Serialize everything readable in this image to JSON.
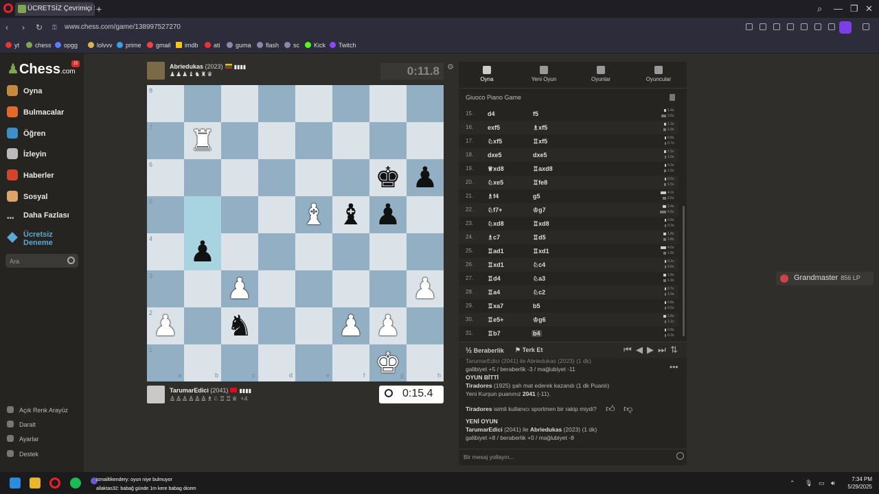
{
  "browser": {
    "tab_title": "ÜCRETSİZ Çevrimiçi S...",
    "url": "www.chess.com/game/138997527270",
    "bookmarks": [
      "yt",
      "chess",
      "opgg",
      "lolvvv",
      "prime",
      "gmail",
      "imdb",
      "ati",
      "guma",
      "flash",
      "sc",
      "Kick",
      "Twitch"
    ]
  },
  "sidebar": {
    "logo": "Chess",
    "logo_suffix": ".com",
    "badge": "15",
    "nav": [
      "Oyna",
      "Bulmacalar",
      "Öğren",
      "İzleyin",
      "Haberler",
      "Sosyal",
      "Daha Fazlası"
    ],
    "premium_line1": "Ücretsiz",
    "premium_line2": "Deneme",
    "search_placeholder": "Ara",
    "bottom": [
      "Açık Renk Arayüz",
      "Daralt",
      "Ayarlar",
      "Destek"
    ]
  },
  "top_player": {
    "name": "Abriedukas",
    "rating": "(2023)",
    "time": "0:11.8",
    "captured": "♟♟♟♝♞♜♛"
  },
  "bottom_player": {
    "name": "TarumarEdici",
    "rating": "(2041)",
    "time": "0:15.4",
    "captured": "♙♙♙♙♙♙♗♘♖♖♕",
    "advantage": "+4"
  },
  "board": {
    "files": [
      "a",
      "b",
      "c",
      "d",
      "e",
      "f",
      "g",
      "h"
    ],
    "ranks": [
      "8",
      "7",
      "6",
      "5",
      "4",
      "3",
      "2",
      "1"
    ],
    "highlight": [
      "b5",
      "b4"
    ],
    "pieces": [
      {
        "sq": "b7",
        "p": "♜",
        "c": "w"
      },
      {
        "sq": "g6",
        "p": "♚",
        "c": "b"
      },
      {
        "sq": "h6",
        "p": "♟",
        "c": "b"
      },
      {
        "sq": "e5",
        "p": "♝",
        "c": "w"
      },
      {
        "sq": "f5",
        "p": "♝",
        "c": "b"
      },
      {
        "sq": "g5",
        "p": "♟",
        "c": "b"
      },
      {
        "sq": "b4",
        "p": "♟",
        "c": "b"
      },
      {
        "sq": "c3",
        "p": "♟",
        "c": "w"
      },
      {
        "sq": "h3",
        "p": "♟",
        "c": "w"
      },
      {
        "sq": "a2",
        "p": "♟",
        "c": "w"
      },
      {
        "sq": "c2",
        "p": "♞",
        "c": "b"
      },
      {
        "sq": "f2",
        "p": "♟",
        "c": "w"
      },
      {
        "sq": "g2",
        "p": "♟",
        "c": "w"
      },
      {
        "sq": "g1",
        "p": "♚",
        "c": "w"
      }
    ]
  },
  "panel": {
    "tabs": [
      "Oyna",
      "Yeni Oyun",
      "Oyunlar",
      "Oyuncular"
    ],
    "opening": "Giuoco Piano Game",
    "moves": [
      {
        "n": "15.",
        "w": "d4",
        "b": "f5",
        "t1": "1.4s",
        "t2": "3.5s",
        "f1": 0.2,
        "f2": 0.5
      },
      {
        "n": "16.",
        "w": "exf5",
        "b": "♗xf5",
        "t1": "1.3s",
        "t2": "1.9s",
        "f1": 0.18,
        "f2": 0.27
      },
      {
        "n": "17.",
        "w": "♘xf5",
        "b": "♖xf5",
        "t1": "0.8s",
        "t2": "0.7s",
        "f1": 0.12,
        "f2": 0.1
      },
      {
        "n": "18.",
        "w": "dxe5",
        "b": "dxe5",
        "t1": "1.5s",
        "t2": "1.0s",
        "f1": 0.21,
        "f2": 0.14
      },
      {
        "n": "19.",
        "w": "♕xd8",
        "b": "♖axd8",
        "t1": "0.3s",
        "t2": "1.5s",
        "f1": 0.05,
        "f2": 0.21
      },
      {
        "n": "20.",
        "w": "♘xe5",
        "b": "♖fe8",
        "t1": "0.5s",
        "t2": "1.5s",
        "f1": 0.07,
        "f2": 0.21
      },
      {
        "n": "21.",
        "w": "♗f4",
        "b": "g5",
        "t1": "4.2s",
        "t2": "2.5s",
        "f1": 0.6,
        "f2": 0.36
      },
      {
        "n": "22.",
        "w": "♘f7+",
        "b": "♔g7",
        "t1": "2.4s",
        "t2": "4.5s",
        "f1": 0.34,
        "f2": 0.64
      },
      {
        "n": "23.",
        "w": "♘xd8",
        "b": "♖xd8",
        "t1": "0.9s",
        "t2": "0.3s",
        "f1": 0.13,
        "f2": 0.05
      },
      {
        "n": "24.",
        "w": "♗c7",
        "b": "♖d5",
        "t1": "1.8s",
        "t2": "1.8s",
        "f1": 0.26,
        "f2": 0.26
      },
      {
        "n": "25.",
        "w": "♖ad1",
        "b": "♖xd1",
        "t1": "4.0s",
        "t2": "1.8s",
        "f1": 0.57,
        "f2": 0.26
      },
      {
        "n": "26.",
        "w": "♖xd1",
        "b": "♘c4",
        "t1": "0.1s",
        "t2": "0.6s",
        "f1": 0.02,
        "f2": 0.09
      },
      {
        "n": "27.",
        "w": "♖d4",
        "b": "♘a3",
        "t1": "1.8s",
        "t2": "1.9s",
        "f1": 0.26,
        "f2": 0.27
      },
      {
        "n": "28.",
        "w": "♖a4",
        "b": "♘c2",
        "t1": "0.7s",
        "t2": "1.0s",
        "f1": 0.1,
        "f2": 0.14
      },
      {
        "n": "29.",
        "w": "♖xa7",
        "b": "b5",
        "t1": "0.8s",
        "t2": "0.5s",
        "f1": 0.12,
        "f2": 0.07
      },
      {
        "n": "30.",
        "w": "♖e5+",
        "b": "♔g6",
        "t1": "1.8s",
        "t2": "1.1s",
        "f1": 0.26,
        "f2": 0.16
      },
      {
        "n": "31.",
        "w": "♖b7",
        "b": "b4",
        "t1": "0.8s",
        "t2": "0.3s",
        "f1": 0.12,
        "f2": 0.05
      }
    ],
    "draw": "Beraberlik",
    "resign": "Terk Et",
    "chat": {
      "l0": "TarumarEdici (2041) ile Abriedukas (2023) (1 dk)",
      "l1": "galibiyet +5 / beraberlik -3 / mağlubiyet -11",
      "h1": "OYUN BİTTİ",
      "l2a": "Tiradores",
      "l2b": " (1925) şah mat ederek kazandı (1 dk Puanlı)",
      "l3a": "Yeni Kurşun puanınız ",
      "l3b": "2041",
      "l3c": " (-11).",
      "l4a": "Tiradores",
      "l4b": " isimli kullanıcı sportmen bir rakip miydi?",
      "h2": "YENİ OYUN",
      "l5a": "TarumarEdici",
      "l5b": " (2041) ile ",
      "l5c": "Abriedukas",
      "l5d": " (2023) (1 dk)",
      "l6": "galibiyet +8 / beraberlik +0 / mağlubiyet -8",
      "placeholder": "Bir mesaj yollayın..."
    }
  },
  "overlay": {
    "rank": "Grandmaster",
    "lp": "856 LP"
  },
  "taskbar": {
    "stream1": "ismailtikendery: oyun niye bulmuyor",
    "stream2": "allaktas32: babağ günde 1m kere babag dicem",
    "time": "7:34 PM",
    "date": "5/29/2025"
  }
}
